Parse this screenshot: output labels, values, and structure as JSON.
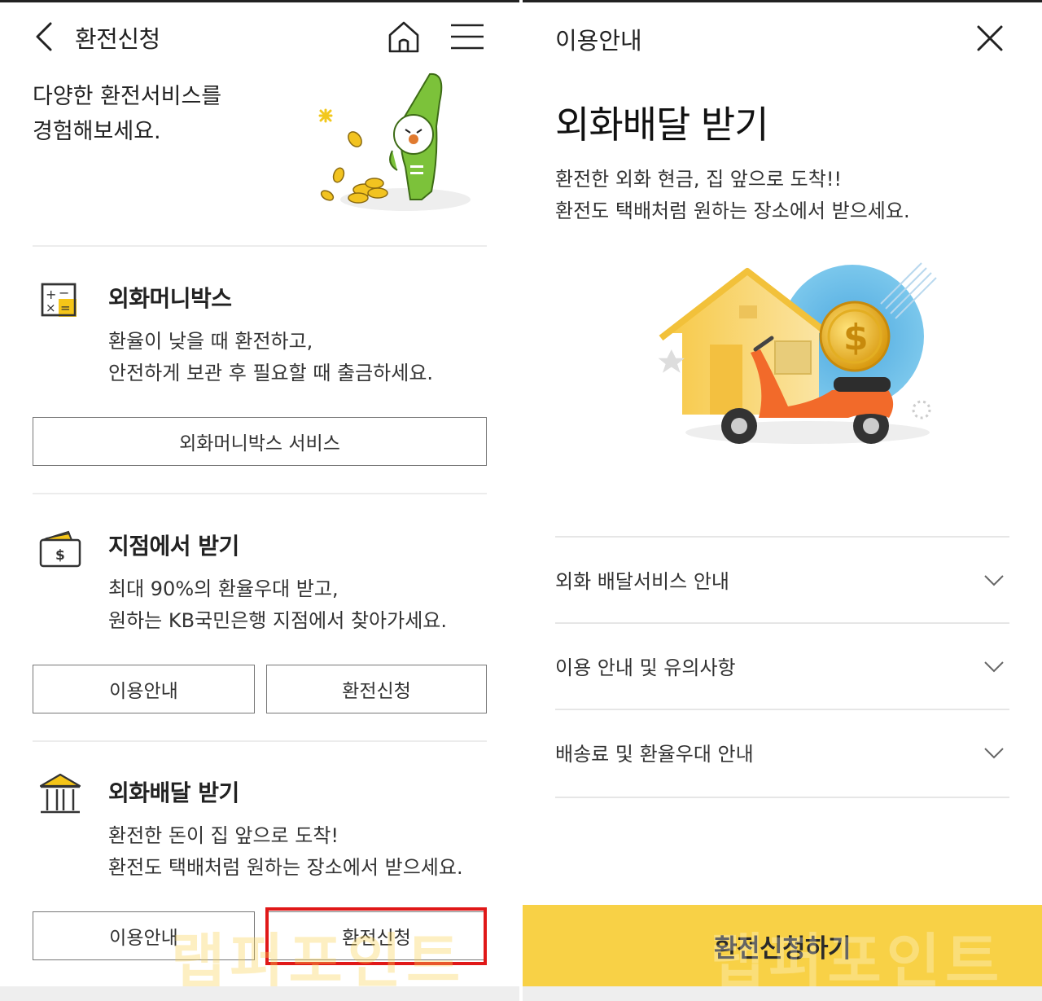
{
  "left": {
    "header": {
      "title": "환전신청"
    },
    "intro": {
      "line1": "다양한 환전서비스를",
      "line2": "경험해보세요."
    },
    "sections": [
      {
        "title": "외화머니박스",
        "desc1": "환율이 낮을 때 환전하고,",
        "desc2": "안전하게 보관 후 필요할 때 출금하세요.",
        "buttons": [
          "외화머니박스 서비스"
        ]
      },
      {
        "title": "지점에서 받기",
        "desc1": "최대 90%의 환율우대 받고,",
        "desc2": "원하는 KB국민은행 지점에서 찾아가세요.",
        "buttons": [
          "이용안내",
          "환전신청"
        ]
      },
      {
        "title": "외화배달 받기",
        "desc1": "환전한 돈이 집 앞으로 도착!",
        "desc2": "환전도 택배처럼 원하는 장소에서 받으세요.",
        "buttons": [
          "이용안내",
          "환전신청"
        ]
      }
    ],
    "watermark": "랩퍼포인트"
  },
  "right": {
    "header": {
      "title": "이용안내"
    },
    "heading": "외화배달 받기",
    "desc1": "환전한 외화 현금, 집 앞으로 도착!!",
    "desc2": "환전도 택배처럼 원하는 장소에서 받으세요.",
    "accordion": [
      {
        "label": "외화 배달서비스 안내"
      },
      {
        "label": "이용 안내 및 유의사항"
      },
      {
        "label": "배송료 및 환율우대 안내"
      }
    ],
    "cta": "환전신청하기",
    "watermark": "랩퍼포인트"
  },
  "colors": {
    "accent": "#f8d146",
    "highlight": "#e01818",
    "icon_yellow": "#f5c518"
  },
  "icons": [
    "chevron-left-icon",
    "home-icon",
    "hamburger-menu-icon",
    "close-icon",
    "calculator-icon",
    "wallet-dollar-icon",
    "bank-building-icon",
    "chevron-down-icon"
  ]
}
